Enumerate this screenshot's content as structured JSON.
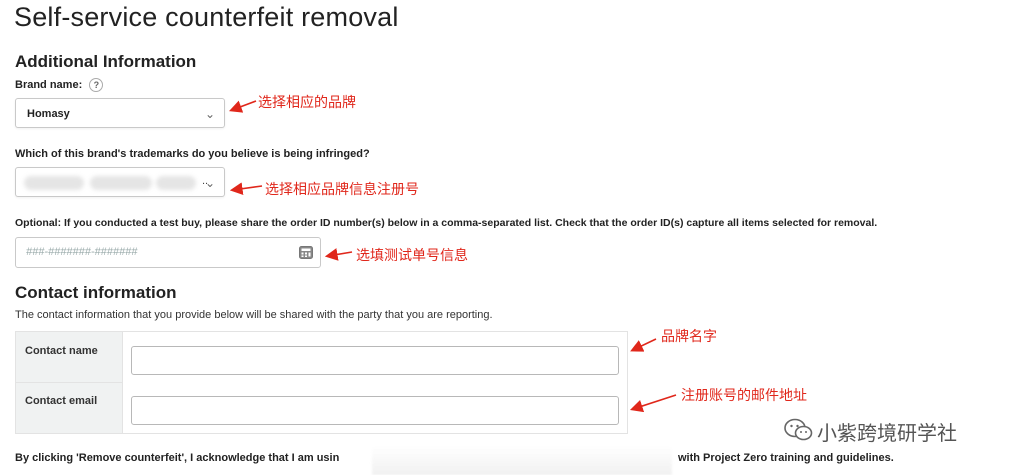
{
  "page": {
    "title": "Self-service counterfeit removal"
  },
  "additional_info": {
    "heading": "Additional Information",
    "brand_label": "Brand name:",
    "brand_help": "?",
    "brand_value": "Homasy",
    "trademark_question": "Which of this brand's trademarks do you believe is being infringed?",
    "trademark_value_suffix": "..",
    "testbuy_label": "Optional: If you conducted a test buy, please share the order ID number(s) below in a comma-separated list. Check that the order ID(s) capture all items selected for removal.",
    "order_placeholder": "###-#######-#######"
  },
  "contact": {
    "heading": "Contact information",
    "description": "The contact information that you provide below will be shared with the party that you are reporting.",
    "name_label": "Contact name",
    "email_label": "Contact email"
  },
  "annotations": {
    "brand_note": "选择相应的品牌",
    "trademark_note": "选择相应品牌信息注册号",
    "order_note": "选填测试单号信息",
    "name_note": "品牌名字",
    "email_note": "注册账号的邮件地址",
    "color": "#e0271b"
  },
  "footer": {
    "ack_start": "By clicking 'Remove counterfeit', I acknowledge that I am usin",
    "ack_end": "with Project Zero training and guidelines."
  },
  "watermark": {
    "text": "小紫跨境研学社",
    "icon": "wechat-icon"
  }
}
